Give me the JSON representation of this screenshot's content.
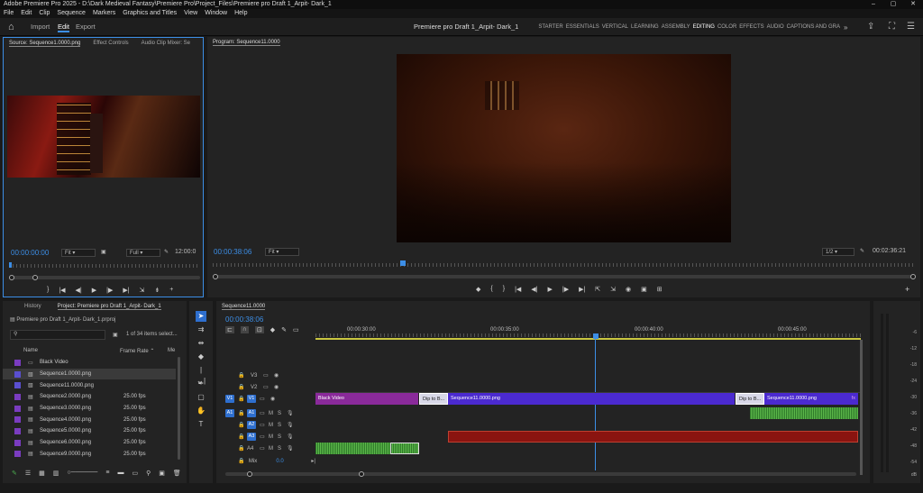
{
  "window": {
    "title": "Adobe Premiere Pro 2025 - D:\\Dark Medieval Fantasy\\Premiere Pro\\Project_Files\\Premiere pro Draft 1_Arpit- Dark_1",
    "controls": [
      "–",
      "▢",
      "✕"
    ]
  },
  "menu": [
    "File",
    "Edit",
    "Clip",
    "Sequence",
    "Markers",
    "Graphics and Titles",
    "View",
    "Window",
    "Help"
  ],
  "header": {
    "modes": [
      "Import",
      "Edit",
      "Export"
    ],
    "active_mode": "Edit",
    "project_name": "Premiere pro Draft 1_Arpit- Dark_1",
    "workspaces": [
      "STARTER",
      "ESSENTIALS",
      "VERTICAL",
      "LEARNING",
      "ASSEMBLY",
      "EDITING",
      "COLOR",
      "EFFECTS",
      "AUDIO",
      "CAPTIONS AND GRA"
    ],
    "active_workspace": "EDITING",
    "more": "»"
  },
  "source": {
    "tabs": [
      "Source: Sequence1.0000.png",
      "Effect Controls",
      "Audio Clip Mixer: Se"
    ],
    "timecode": "00:00:00:00",
    "zoom": "Fit",
    "resolution": "Full",
    "duration": "12:00:0",
    "playhead_fraction": 0.0
  },
  "program": {
    "tab": "Program: Sequence11.0000",
    "timecode": "00:00:38:06",
    "zoom": "Fit",
    "resolution": "1/2",
    "duration": "00:02:36:21",
    "playhead_fraction": 0.27
  },
  "project": {
    "tabs": [
      "History",
      "Project: Premiere pro Draft 1_Arpit- Dark_1"
    ],
    "file": "Premiere pro Draft 1_Arpit- Dark_1.prproj",
    "selection": "1 of 34 items select...",
    "columns": {
      "name": "Name",
      "rate": "Frame Rate",
      "media": "Me"
    },
    "items": [
      {
        "name": "Black Video",
        "fps": "",
        "color": "#7a3cc0"
      },
      {
        "name": "Sequence1.0000.png",
        "fps": "",
        "color": "#5a4fd0"
      },
      {
        "name": "Sequence11.0000.png",
        "fps": "",
        "color": "#5a4fd0"
      },
      {
        "name": "Sequence2.0000.png",
        "fps": "25.00 fps",
        "color": "#7a3cc0"
      },
      {
        "name": "Sequence3.0000.png",
        "fps": "25.00 fps",
        "color": "#7a3cc0"
      },
      {
        "name": "Sequence4.0000.png",
        "fps": "25.00 fps",
        "color": "#7a3cc0"
      },
      {
        "name": "Sequence5.0000.png",
        "fps": "25.00 fps",
        "color": "#7a3cc0"
      },
      {
        "name": "Sequence6.0000.png",
        "fps": "25.00 fps",
        "color": "#7a3cc0"
      },
      {
        "name": "Sequence9.0000.png",
        "fps": "25.00 fps",
        "color": "#7a3cc0"
      }
    ]
  },
  "timeline": {
    "tab": "Sequence11.0000",
    "timecode": "00:00:38:06",
    "ruler": [
      "00:00:30:00",
      "00:00:35:00",
      "00:00:40:00",
      "00:00:45:00"
    ],
    "tracks": [
      {
        "id": "V3",
        "type": "video"
      },
      {
        "id": "V2",
        "type": "video"
      },
      {
        "id": "V1",
        "type": "video",
        "source": "V1"
      },
      {
        "id": "A1",
        "type": "audio",
        "source": "A1"
      },
      {
        "id": "A2",
        "type": "audio"
      },
      {
        "id": "A3",
        "type": "audio"
      },
      {
        "id": "A4",
        "type": "audio"
      }
    ],
    "mix": {
      "label": "Mix",
      "value": "0.0"
    },
    "clips": {
      "black_video": "Black Video",
      "dip1": "Dip to B...",
      "seq1": "Sequence11.0000.png",
      "dip2": "Dip to B...",
      "seq2": "Sequence11.0000.png",
      "fx": "fx"
    }
  },
  "meter": {
    "scale": [
      "-6",
      "-12",
      "-18",
      "-24",
      "-30",
      "-36",
      "-42",
      "-48",
      "-54",
      "dB"
    ]
  }
}
